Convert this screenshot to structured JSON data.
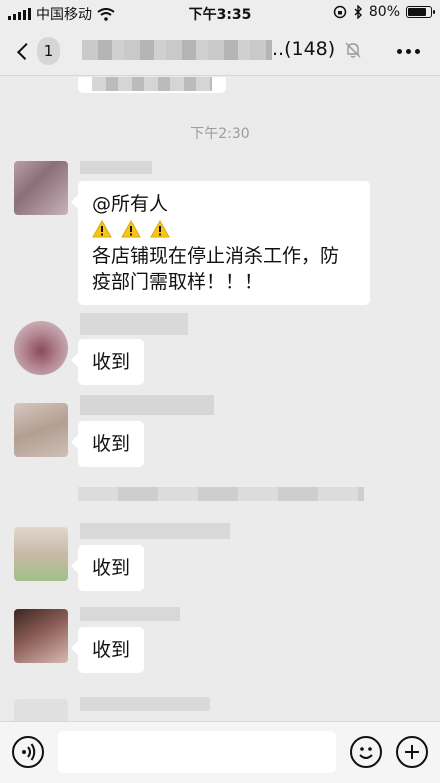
{
  "status_bar": {
    "carrier": "中国移动",
    "time": "下午3:35",
    "battery": "80%",
    "battery_level": 0.8
  },
  "nav": {
    "back_badge": "1",
    "title_suffix": "..(148)"
  },
  "chat": {
    "timestamp": "下午2:30",
    "announcement": {
      "line1": "@所有人",
      "line3": "各店铺现在停止消杀工作，防",
      "line4": "疫部门需取样！！！"
    },
    "replies": [
      {
        "text": "收到"
      },
      {
        "text": "收到"
      },
      {
        "text": "收到"
      },
      {
        "text": "收到"
      }
    ]
  },
  "colors": {
    "background": "#ebebeb",
    "bubble": "#ffffff",
    "warning": "#f5c518"
  },
  "icons": [
    "signal-icon",
    "wifi-icon",
    "lock-rotation-icon",
    "bluetooth-icon",
    "battery-icon",
    "back-arrow-icon",
    "mute-bell-icon",
    "more-icon",
    "voice-icon",
    "emoji-icon",
    "plus-icon",
    "warning-icon"
  ]
}
